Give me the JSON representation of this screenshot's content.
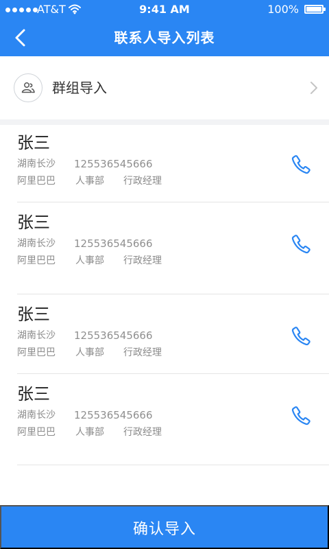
{
  "status_bar": {
    "carrier": "AT&T",
    "time": "9:41 AM",
    "battery": "100%"
  },
  "header": {
    "title": "联系人导入列表",
    "back_icon": "chevron-left-icon"
  },
  "group_import": {
    "label": "群组导入",
    "icon": "group-icon",
    "chevron_icon": "chevron-right-icon"
  },
  "contacts": [
    {
      "name": "张三",
      "region": "湖南长沙",
      "phone": "125536545666",
      "company": "阿里巴巴",
      "department": "人事部",
      "position": "行政经理"
    },
    {
      "name": "张三",
      "region": "湖南长沙",
      "phone": "125536545666",
      "company": "阿里巴巴",
      "department": "人事部",
      "position": "行政经理"
    },
    {
      "name": "张三",
      "region": "湖南长沙",
      "phone": "125536545666",
      "company": "阿里巴巴",
      "department": "人事部",
      "position": "行政经理"
    },
    {
      "name": "张三",
      "region": "湖南长沙",
      "phone": "125536545666",
      "company": "阿里巴巴",
      "department": "人事部",
      "position": "行政经理"
    }
  ],
  "footer": {
    "confirm_label": "确认导入"
  },
  "colors": {
    "primary": "#2a86f3",
    "text": "#222222",
    "secondary_text": "#8b8b8b",
    "divider": "#e5e5e5"
  }
}
